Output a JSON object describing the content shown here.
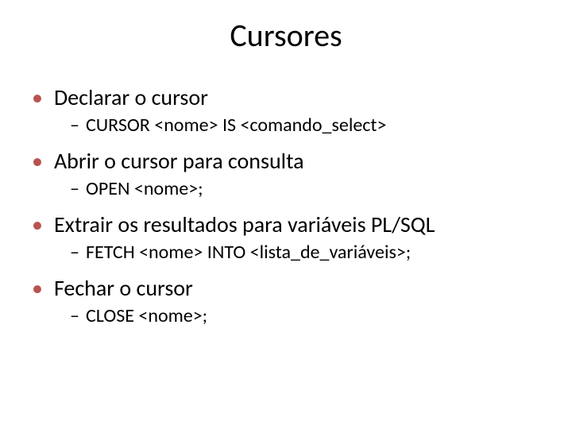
{
  "title": "Cursores",
  "items": [
    {
      "heading": "Declarar o cursor",
      "detail": "CURSOR <nome> IS <comando_select>"
    },
    {
      "heading": "Abrir o cursor para consulta",
      "detail": "OPEN <nome>;"
    },
    {
      "heading": "Extrair os resultados para variáveis PL/SQL",
      "detail": "FETCH <nome> INTO <lista_de_variáveis>;"
    },
    {
      "heading": "Fechar o cursor",
      "detail": "CLOSE <nome>;"
    }
  ]
}
